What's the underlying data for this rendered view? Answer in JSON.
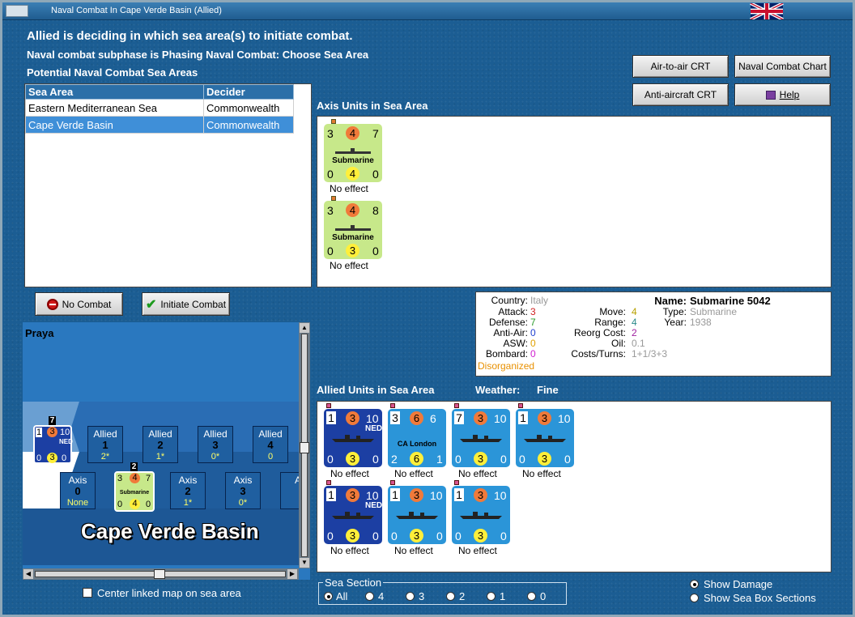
{
  "window": {
    "title": "Naval Combat In Cape Verde Basin (Allied)"
  },
  "header": {
    "line1": "Allied is deciding in which sea area(s) to initiate combat.",
    "line2": "Naval combat subphase is Phasing Naval Combat: Choose Sea Area",
    "line3": "Potential Naval Combat Sea Areas"
  },
  "buttons": {
    "air_to_air": "Air-to-air CRT",
    "naval_chart": "Naval Combat Chart",
    "anti_aircraft": "Anti-aircraft CRT",
    "help": "Help",
    "no_combat": "No Combat",
    "initiate_combat": "Initiate Combat"
  },
  "sea_table": {
    "headers": [
      "Sea Area",
      "Decider"
    ],
    "rows": [
      [
        "Eastern Mediterranean Sea",
        "Commonwealth"
      ],
      [
        "Cape Verde Basin",
        "Commonwealth"
      ]
    ],
    "selected_row": 1
  },
  "axis_panel": {
    "label": "Axis Units in Sea Area",
    "units": [
      {
        "top": [
          "3",
          "4",
          "7"
        ],
        "type": "Submarine",
        "bottom": [
          "0",
          "4",
          "0"
        ],
        "effect": "No effect"
      },
      {
        "top": [
          "3",
          "4",
          "8"
        ],
        "type": "Submarine",
        "bottom": [
          "0",
          "3",
          "0"
        ],
        "effect": "No effect"
      }
    ]
  },
  "details": {
    "country_label": "Country:",
    "country": "Italy",
    "attack_label": "Attack:",
    "attack": "3",
    "defense_label": "Defense:",
    "defense": "7",
    "antiair_label": "Anti-Air:",
    "antiair": "0",
    "asw_label": "ASW:",
    "asw": "0",
    "bombard_label": "Bombard:",
    "bombard": "0",
    "status": "Disorganized",
    "move_label": "Move:",
    "move": "4",
    "range_label": "Range:",
    "range": "4",
    "reorg_label": "Reorg Cost:",
    "reorg": "2",
    "oil_label": "Oil:",
    "oil": "0.1",
    "costs_label": "Costs/Turns:",
    "costs": "1+1/3+3",
    "name_label": "Name:",
    "name": "Submarine 5042",
    "type_label": "Type:",
    "type": "Submarine",
    "year_label": "Year:",
    "year": "1938"
  },
  "allied_panel": {
    "label": "Allied Units in Sea Area",
    "weather_label": "Weather:",
    "weather": "Fine",
    "units": [
      {
        "style": "navy",
        "top": [
          "1",
          "3",
          "10"
        ],
        "nation": "NED",
        "bottom": [
          "0",
          "3",
          "0"
        ],
        "effect": "No effect"
      },
      {
        "style": "cyan",
        "top": [
          "3",
          "6",
          "6"
        ],
        "name": "CA London",
        "bottom": [
          "2",
          "6",
          "1"
        ],
        "effect": "No effect"
      },
      {
        "style": "cyan",
        "top": [
          "7",
          "3",
          "10"
        ],
        "bottom": [
          "0",
          "3",
          "0"
        ],
        "effect": "No effect"
      },
      {
        "style": "cyan",
        "top": [
          "1",
          "3",
          "10"
        ],
        "bottom": [
          "0",
          "3",
          "0"
        ],
        "effect": "No effect"
      },
      {
        "style": "navy",
        "top": [
          "1",
          "3",
          "10"
        ],
        "nation": "NED",
        "bottom": [
          "0",
          "3",
          "0"
        ],
        "effect": "No effect"
      },
      {
        "style": "cyan",
        "top": [
          "1",
          "3",
          "10"
        ],
        "bottom": [
          "0",
          "3",
          "0"
        ],
        "effect": "No effect"
      },
      {
        "style": "cyan",
        "top": [
          "1",
          "3",
          "10"
        ],
        "bottom": [
          "0",
          "3",
          "0"
        ],
        "effect": "No effect"
      }
    ]
  },
  "map": {
    "place": "Praya",
    "area_name": "Cape Verde Basin",
    "allied_boxes": [
      {
        "label": "Allied",
        "num": "1",
        "val": "2*"
      },
      {
        "label": "Allied",
        "num": "2",
        "val": "1*"
      },
      {
        "label": "Allied",
        "num": "3",
        "val": "0*"
      },
      {
        "label": "Allied",
        "num": "4",
        "val": "0"
      }
    ],
    "axis_boxes": [
      {
        "label": "Axis",
        "num": "0",
        "val": "None"
      },
      {
        "label": "Axis",
        "num": "2",
        "val": "1*"
      },
      {
        "label": "Axis",
        "num": "3",
        "val": "0*"
      },
      {
        "label": "A",
        "num": "",
        "val": ""
      }
    ],
    "stack_allied": "7",
    "stack_axis": "2",
    "mini_allied": {
      "top": [
        "1",
        "3",
        "10"
      ],
      "nation": "NED",
      "bottom": [
        "0",
        "3",
        "0"
      ]
    },
    "mini_axis": {
      "top": [
        "3",
        "4",
        "7"
      ],
      "type": "Submarine",
      "bottom": [
        "0",
        "4",
        "0"
      ]
    }
  },
  "center_linked": "Center linked map on sea area",
  "sea_section": {
    "label": "Sea Section",
    "options": [
      "All",
      "4",
      "3",
      "2",
      "1",
      "0"
    ],
    "selected": 0
  },
  "view_options": {
    "show_damage": "Show Damage",
    "show_sections": "Show Sea Box Sections",
    "selected": 0
  }
}
